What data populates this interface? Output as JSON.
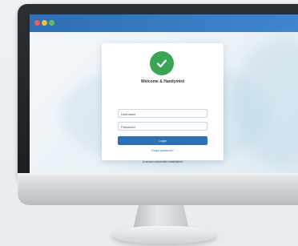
{
  "window": {
    "controls": [
      "close",
      "minimize",
      "maximize"
    ]
  },
  "login": {
    "title": "Welcome & Handymint",
    "username_placeholder": "Username",
    "password_placeholder": "Password",
    "submit_label": "Login",
    "forgot_label": "Forgot password?",
    "footer_text": "A secure connection established"
  },
  "colors": {
    "titlebar": "#2f6fb3",
    "accent": "#2f6fb3",
    "success": "#3aa655"
  },
  "icons": {
    "status": "check-icon"
  }
}
